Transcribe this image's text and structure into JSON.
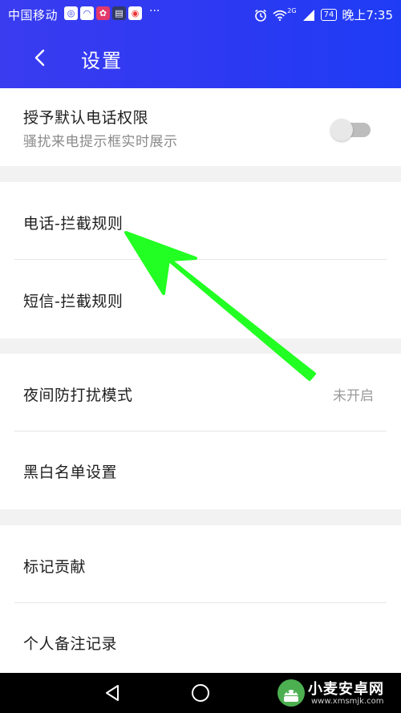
{
  "status_bar": {
    "carrier": "中国移动",
    "app_icons": [
      "browser-icon",
      "chat-icon",
      "game-icon",
      "media-icon",
      "weibo-icon"
    ],
    "more": "···",
    "network": "2G",
    "battery": "74",
    "time": "晚上7:35"
  },
  "header": {
    "title": "设置",
    "back_icon": "chevron-left-icon"
  },
  "settings": {
    "grant_default_phone": {
      "label": "授予默认电话权限",
      "sub": "骚扰来电提示框实时展示",
      "toggle_on": false
    },
    "phone_block_rules": {
      "label": "电话-拦截规则"
    },
    "sms_block_rules": {
      "label": "短信-拦截规则"
    },
    "night_dnd": {
      "label": "夜间防打扰模式",
      "value": "未开启"
    },
    "black_white_list": {
      "label": "黑白名单设置"
    },
    "mark_contribution": {
      "label": "标记贡献"
    },
    "personal_notes": {
      "label": "个人备注记录"
    }
  },
  "nav_bar": {
    "back": "triangle-back-icon",
    "home": "circle-home-icon",
    "recent": "square-recent-icon"
  },
  "watermark": {
    "title": "小麦安卓网",
    "url": "www.xmsmjk.com"
  },
  "colors": {
    "header": "#2d39f2",
    "annotation_arrow": "#22ff22",
    "background": "#f2f2f2"
  }
}
